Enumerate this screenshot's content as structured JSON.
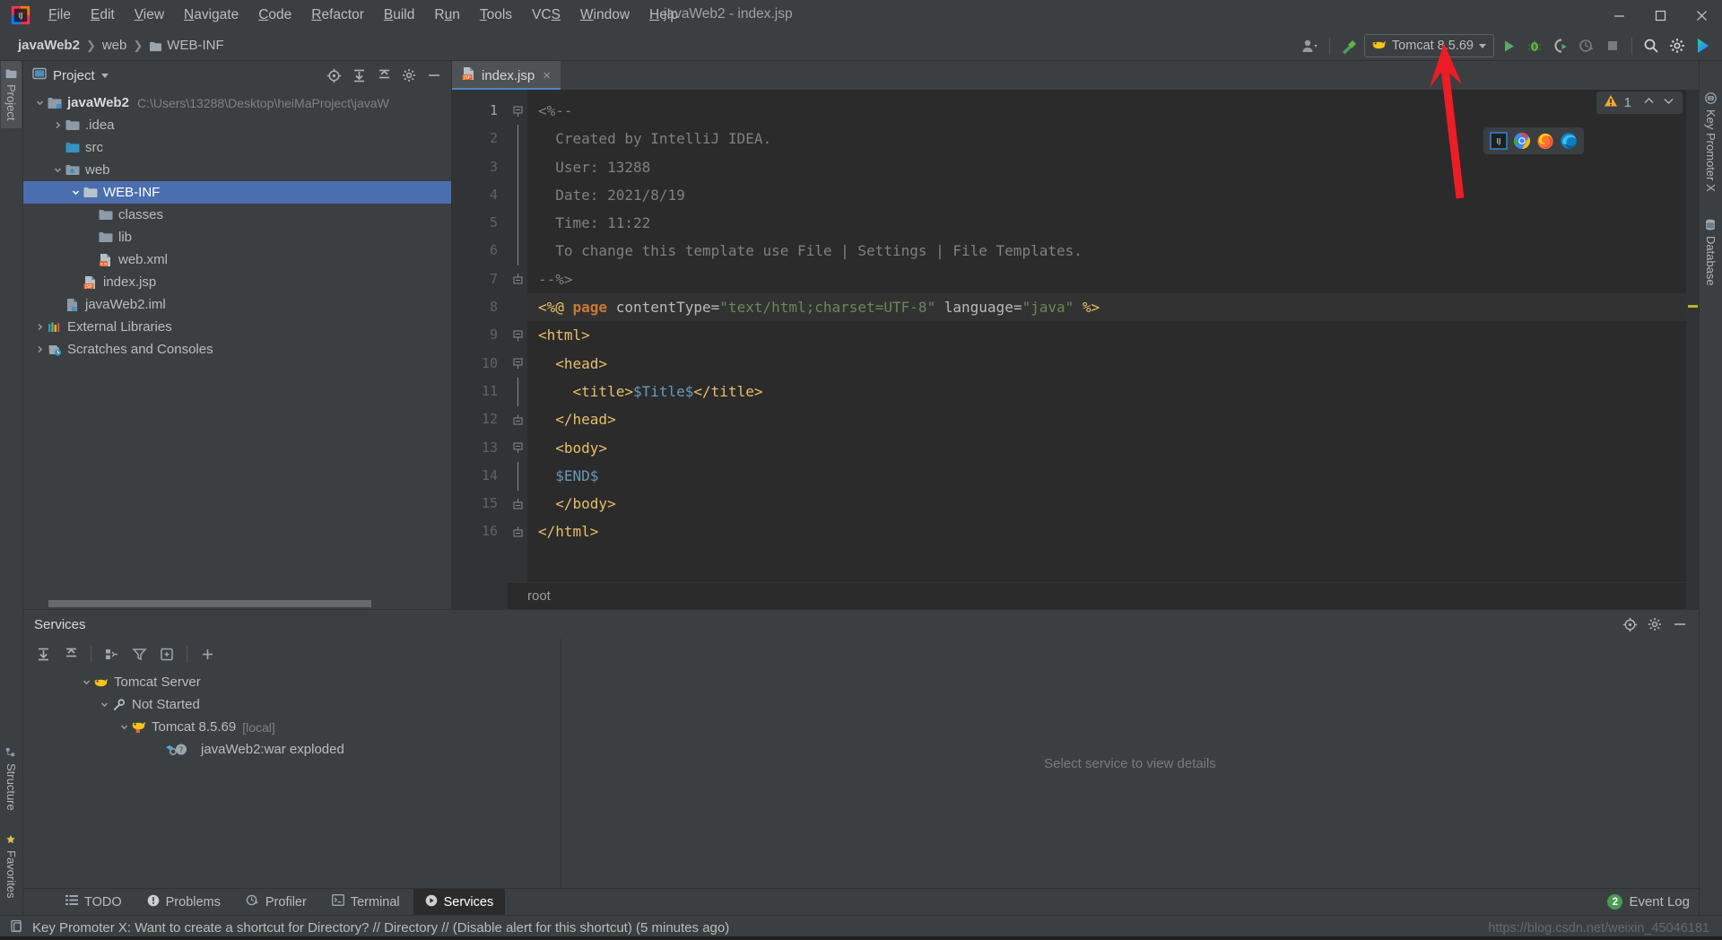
{
  "window": {
    "title": "javaWeb2 - index.jsp",
    "app_icon": "intellij-idea-logo"
  },
  "menu": {
    "items": [
      {
        "label": "File",
        "mnemonic": "F"
      },
      {
        "label": "Edit",
        "mnemonic": "E"
      },
      {
        "label": "View",
        "mnemonic": "V"
      },
      {
        "label": "Navigate",
        "mnemonic": "N"
      },
      {
        "label": "Code",
        "mnemonic": "C"
      },
      {
        "label": "Refactor",
        "mnemonic": "R"
      },
      {
        "label": "Build",
        "mnemonic": "B"
      },
      {
        "label": "Run",
        "mnemonic": "u"
      },
      {
        "label": "Tools",
        "mnemonic": "T"
      },
      {
        "label": "VCS",
        "mnemonic": "S"
      },
      {
        "label": "Window",
        "mnemonic": "W"
      },
      {
        "label": "Help",
        "mnemonic": "H"
      }
    ]
  },
  "navbar": {
    "crumbs": [
      {
        "label": "javaWeb2",
        "icon": "module-icon"
      },
      {
        "label": "web",
        "icon": "folder-icon"
      },
      {
        "label": "WEB-INF",
        "icon": "folder-icon"
      }
    ],
    "separator": "›"
  },
  "toolbar": {
    "user_icon": "user-silhouette-icon",
    "build_icon": "hammer-build-icon",
    "run_config": {
      "name": "Tomcat 8.5.69",
      "icon": "tomcat-cat-icon"
    },
    "actions": [
      {
        "name": "run-button",
        "icon": "green-play-icon"
      },
      {
        "name": "debug-button",
        "icon": "green-bug-icon"
      },
      {
        "name": "run-with-coverage-button",
        "icon": "coverage-icon"
      },
      {
        "name": "profile-button",
        "icon": "profiler-icon"
      },
      {
        "name": "stop-button",
        "icon": "stop-square-icon"
      },
      {
        "name": "search-everywhere-button",
        "icon": "magnifier-icon"
      },
      {
        "name": "settings-button",
        "icon": "gear-icon"
      },
      {
        "name": "ide-assistant-button",
        "icon": "colored-chevron-icon"
      }
    ]
  },
  "left_rail": {
    "tabs": [
      {
        "label": "Project",
        "icon": "folder-icon",
        "active": true
      },
      {
        "label": "Structure",
        "icon": "structure-icon",
        "active": false
      },
      {
        "label": "Favorites",
        "icon": "star-icon",
        "active": false
      }
    ]
  },
  "right_rail": {
    "tabs": [
      {
        "label": "Key Promoter X",
        "icon": "key-promoter-icon"
      },
      {
        "label": "Database",
        "icon": "database-icon"
      }
    ]
  },
  "project_panel": {
    "title": "Project",
    "dropdown_caret": "▾",
    "actions": [
      {
        "name": "select-opened-file-button",
        "icon": "crosshair-target-icon"
      },
      {
        "name": "expand-all-button",
        "icon": "expand-all-icon"
      },
      {
        "name": "collapse-all-button",
        "icon": "collapse-all-icon"
      },
      {
        "name": "tool-window-settings-button",
        "icon": "gear-icon"
      },
      {
        "name": "hide-tool-window-button",
        "icon": "minimize-icon"
      }
    ],
    "tree": [
      {
        "label": "javaWeb2",
        "path": "C:\\Users\\13288\\Desktop\\heiMaProject\\javaW",
        "indent": 0,
        "arrow": "down",
        "icon": "module-icon",
        "bold": true,
        "selected": false
      },
      {
        "label": ".idea",
        "path": "",
        "indent": 1,
        "arrow": "right",
        "icon": "folder-icon",
        "bold": false,
        "selected": false
      },
      {
        "label": "src",
        "path": "",
        "indent": 1,
        "arrow": "none",
        "icon": "source-folder-icon",
        "bold": false,
        "selected": false
      },
      {
        "label": "web",
        "path": "",
        "indent": 1,
        "arrow": "down",
        "icon": "web-folder-icon",
        "bold": false,
        "selected": false
      },
      {
        "label": "WEB-INF",
        "path": "",
        "indent": 2,
        "arrow": "down",
        "icon": "folder-icon",
        "bold": false,
        "selected": true
      },
      {
        "label": "classes",
        "path": "",
        "indent": 3,
        "arrow": "none",
        "icon": "folder-icon",
        "bold": false,
        "selected": false
      },
      {
        "label": "lib",
        "path": "",
        "indent": 3,
        "arrow": "none",
        "icon": "folder-icon",
        "bold": false,
        "selected": false
      },
      {
        "label": "web.xml",
        "path": "",
        "indent": 3,
        "arrow": "none",
        "icon": "xml-file-icon",
        "bold": false,
        "selected": false
      },
      {
        "label": "index.jsp",
        "path": "",
        "indent": 2,
        "arrow": "none",
        "icon": "jsp-file-icon",
        "bold": false,
        "selected": false
      },
      {
        "label": "javaWeb2.iml",
        "path": "",
        "indent": 1,
        "arrow": "none",
        "icon": "iml-file-icon",
        "bold": false,
        "selected": false
      },
      {
        "label": "External Libraries",
        "path": "",
        "indent": 0,
        "arrow": "right",
        "icon": "libraries-icon",
        "bold": false,
        "selected": false
      },
      {
        "label": "Scratches and Consoles",
        "path": "",
        "indent": 0,
        "arrow": "right",
        "icon": "scratches-icon",
        "bold": false,
        "selected": false
      }
    ]
  },
  "editor": {
    "tab": {
      "label": "index.jsp",
      "icon": "jsp-file-icon",
      "close": "×"
    },
    "inspection": {
      "warning_count": "1",
      "icon": "warning-triangle-icon",
      "up": "⌃",
      "down": "⌄"
    },
    "browsers": [
      {
        "name": "open-in-intellij-builtin-preview",
        "icon": "intellij-icon"
      },
      {
        "name": "open-in-chrome",
        "icon": "chrome-icon"
      },
      {
        "name": "open-in-firefox",
        "icon": "firefox-icon"
      },
      {
        "name": "open-in-edge",
        "icon": "edge-icon"
      }
    ],
    "status_root": "root",
    "lines": [
      {
        "n": "1",
        "fold": "start",
        "highlight": false,
        "tokens": [
          {
            "t": "<%--",
            "c": "tok-comment"
          }
        ]
      },
      {
        "n": "2",
        "fold": "none",
        "highlight": false,
        "tokens": [
          {
            "t": "  Created by IntelliJ IDEA.",
            "c": "tok-comment"
          }
        ]
      },
      {
        "n": "3",
        "fold": "none",
        "highlight": false,
        "tokens": [
          {
            "t": "  User: 13288",
            "c": "tok-comment"
          }
        ]
      },
      {
        "n": "4",
        "fold": "none",
        "highlight": false,
        "tokens": [
          {
            "t": "  Date: 2021/8/19",
            "c": "tok-comment"
          }
        ]
      },
      {
        "n": "5",
        "fold": "none",
        "highlight": false,
        "tokens": [
          {
            "t": "  Time: 11:22",
            "c": "tok-comment"
          }
        ]
      },
      {
        "n": "6",
        "fold": "none",
        "highlight": false,
        "tokens": [
          {
            "t": "  To change this template use File | Settings | File Templates.",
            "c": "tok-comment"
          }
        ]
      },
      {
        "n": "7",
        "fold": "end",
        "highlight": false,
        "tokens": [
          {
            "t": "--%>",
            "c": "tok-comment"
          }
        ]
      },
      {
        "n": "8",
        "fold": "none",
        "highlight": true,
        "tokens": [
          {
            "t": "<%@ ",
            "c": "tok-directive"
          },
          {
            "t": "page",
            "c": "tok-kw"
          },
          {
            "t": " contentType=",
            "c": "tok-attr"
          },
          {
            "t": "\"text/html;charset=UTF-8\"",
            "c": "tok-str"
          },
          {
            "t": " language=",
            "c": "tok-attr"
          },
          {
            "t": "\"java\"",
            "c": "tok-str"
          },
          {
            "t": " %>",
            "c": "tok-directive"
          }
        ]
      },
      {
        "n": "9",
        "fold": "start",
        "highlight": false,
        "tokens": [
          {
            "t": "<html>",
            "c": "tok-tag"
          }
        ]
      },
      {
        "n": "10",
        "fold": "start",
        "highlight": false,
        "tokens": [
          {
            "t": "  <head>",
            "c": "tok-tag"
          }
        ]
      },
      {
        "n": "11",
        "fold": "none",
        "highlight": false,
        "tokens": [
          {
            "t": "    <title>",
            "c": "tok-tag"
          },
          {
            "t": "$Title$",
            "c": "tok-el"
          },
          {
            "t": "</title>",
            "c": "tok-tag"
          }
        ]
      },
      {
        "n": "12",
        "fold": "end",
        "highlight": false,
        "tokens": [
          {
            "t": "  </head>",
            "c": "tok-tag"
          }
        ]
      },
      {
        "n": "13",
        "fold": "start",
        "highlight": false,
        "tokens": [
          {
            "t": "  <body>",
            "c": "tok-tag"
          }
        ]
      },
      {
        "n": "14",
        "fold": "none",
        "highlight": false,
        "tokens": [
          {
            "t": "  $END$",
            "c": "tok-el"
          }
        ]
      },
      {
        "n": "15",
        "fold": "end",
        "highlight": false,
        "tokens": [
          {
            "t": "  </body>",
            "c": "tok-tag"
          }
        ]
      },
      {
        "n": "16",
        "fold": "end",
        "highlight": false,
        "tokens": [
          {
            "t": "</html>",
            "c": "tok-tag"
          }
        ]
      }
    ]
  },
  "services": {
    "title": "Services",
    "header_actions": [
      {
        "name": "services-help-button",
        "icon": "crosshair-target-icon"
      },
      {
        "name": "services-settings-button",
        "icon": "gear-icon"
      },
      {
        "name": "services-hide-button",
        "icon": "minimize-icon"
      }
    ],
    "toolbar": [
      {
        "name": "expand-all-button",
        "icon": "expand-all-icon"
      },
      {
        "name": "collapse-all-button",
        "icon": "collapse-all-icon"
      },
      {
        "name": "group-by-button",
        "icon": "group-icon"
      },
      {
        "name": "filter-button",
        "icon": "funnel-icon"
      },
      {
        "name": "show-configurations-button",
        "icon": "configurations-icon"
      },
      {
        "name": "add-service-button",
        "icon": "plus-icon"
      }
    ],
    "tree": [
      {
        "label": "Tomcat Server",
        "suffix": "",
        "indent": 0,
        "arrow": "down",
        "icon": "tomcat-cat-icon"
      },
      {
        "label": "Not Started",
        "suffix": "",
        "indent": 1,
        "arrow": "down",
        "icon": "wrench-icon"
      },
      {
        "label": "Tomcat 8.5.69",
        "suffix": "[local]",
        "indent": 2,
        "arrow": "down",
        "icon": "tomcat-cat-icon"
      },
      {
        "label": "javaWeb2:war exploded",
        "suffix": "",
        "indent": 3,
        "arrow": "none",
        "icon": "artifact-question-icon"
      }
    ],
    "empty_detail": "Select service to view details"
  },
  "bottom_tabs": {
    "tabs": [
      {
        "label": "TODO",
        "icon": "todo-list-icon",
        "active": false
      },
      {
        "label": "Problems",
        "icon": "problems-icon",
        "active": false
      },
      {
        "label": "Profiler",
        "icon": "profiler-icon",
        "active": false
      },
      {
        "label": "Terminal",
        "icon": "terminal-icon",
        "active": false
      },
      {
        "label": "Services",
        "icon": "services-play-icon",
        "active": true
      }
    ],
    "event_log": {
      "label": "Event Log",
      "count": "2"
    }
  },
  "statusbar": {
    "icon": "notification-icon",
    "message": "Key Promoter X: Want to create a shortcut for Directory? // Directory // (Disable alert for this shortcut) (5 minutes ago)",
    "watermark": "https://blog.csdn.net/weixin_45046181"
  },
  "annotation": {
    "arrow_color": "#ee1c25"
  }
}
